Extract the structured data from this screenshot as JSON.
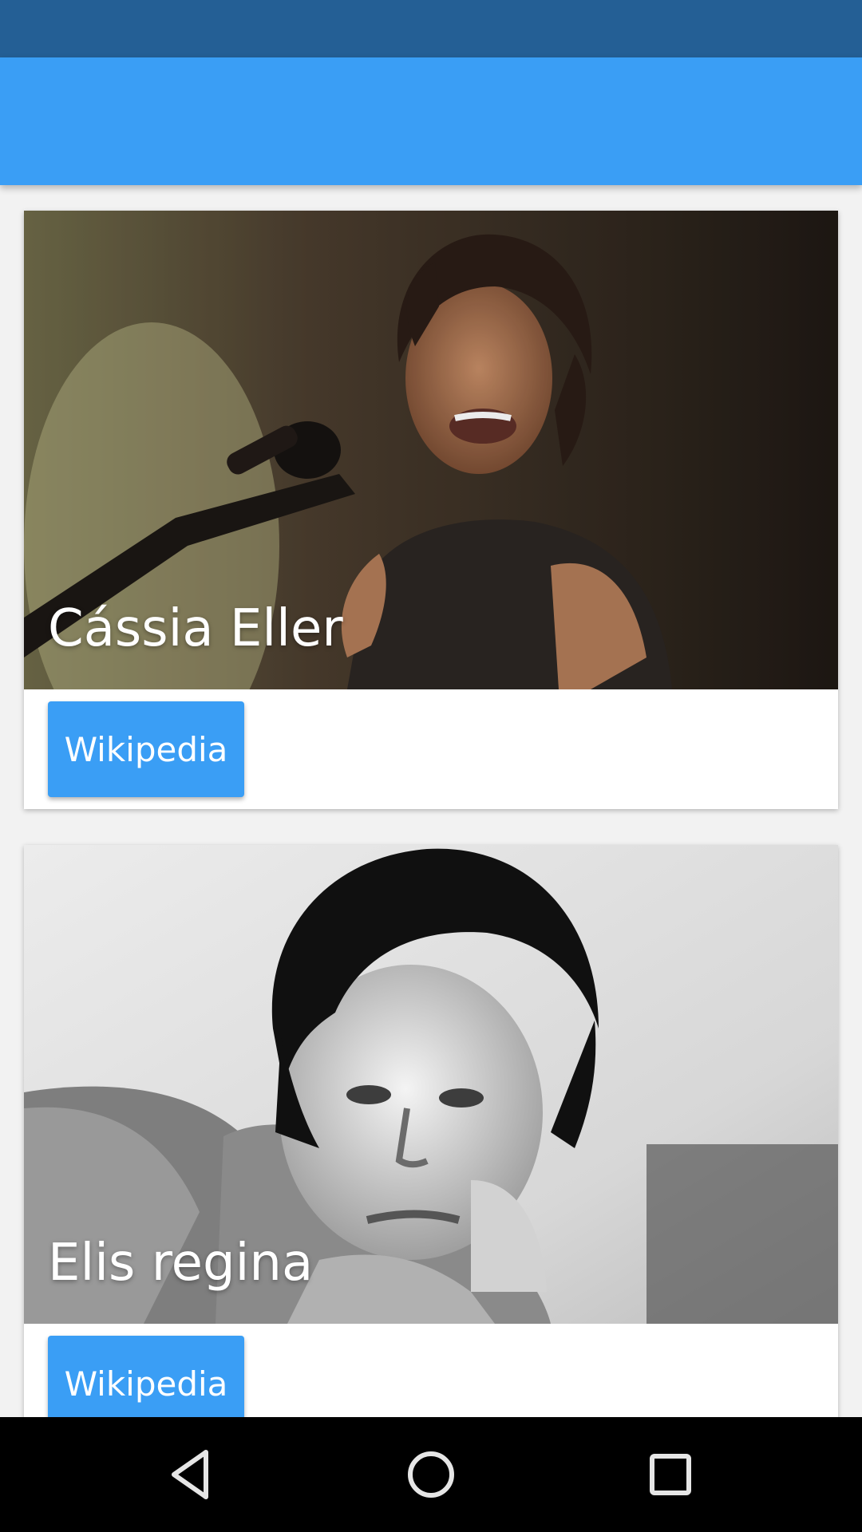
{
  "cards": [
    {
      "title": "Cássia Eller",
      "button_label": "Wikipedia"
    },
    {
      "title": "Elis regina",
      "button_label": "Wikipedia"
    }
  ],
  "navigation": {
    "back_icon": "triangle-back-icon",
    "home_icon": "circle-home-icon",
    "recents_icon": "square-recents-icon"
  },
  "colors": {
    "status_bar": "#245f95",
    "app_bar": "#3a9ef5",
    "button": "#3a9ef5",
    "nav_bar": "#000000"
  }
}
